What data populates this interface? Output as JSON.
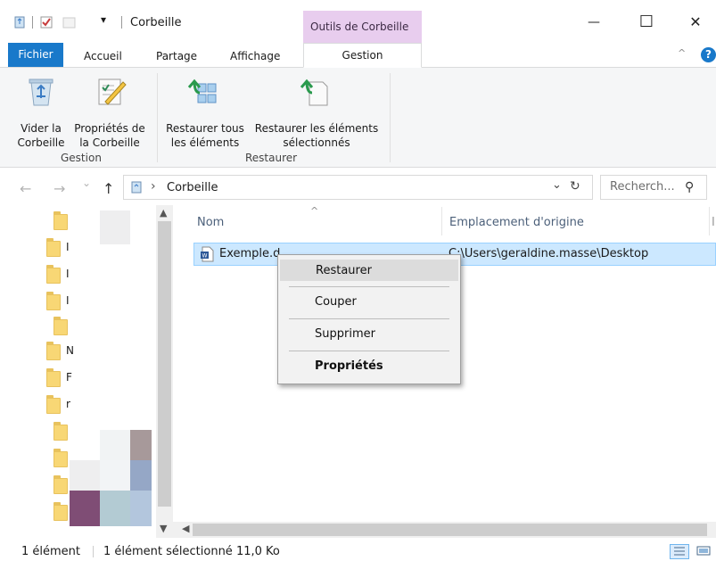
{
  "window": {
    "title": "Corbeille",
    "context_tab_header": "Outils de Corbeille",
    "minimize_glyph": "—",
    "maximize_glyph": "☐",
    "close_glyph": "✕"
  },
  "ribbon_tabs": {
    "file": "Fichier",
    "home": "Accueil",
    "share": "Partage",
    "view": "Affichage",
    "manage": "Gestion",
    "help_glyph": "?",
    "collapse_glyph": "^"
  },
  "ribbon": {
    "empty_bin_line1": "Vider la",
    "empty_bin_line2": "Corbeille",
    "bin_props_line1": "Propriétés de",
    "bin_props_line2": "la Corbeille",
    "group_manage": "Gestion",
    "restore_all_line1": "Restaurer tous",
    "restore_all_line2": "les éléments",
    "restore_sel_line1": "Restaurer les éléments",
    "restore_sel_line2": "sélectionnés",
    "group_restore": "Restaurer"
  },
  "address": {
    "back_glyph": "←",
    "forward_glyph": "→",
    "recent_glyph": "⌄",
    "up_glyph": "↑",
    "separator_glyph": "›",
    "location": "Corbeille",
    "dropdown_glyph": "⌄",
    "refresh_glyph": "↻",
    "search_placeholder": "Recherch...",
    "search_glyph": "⚲"
  },
  "navpane": {
    "labels": [
      "I",
      "I",
      "I",
      "N",
      "F",
      "r"
    ]
  },
  "filelist": {
    "columns": {
      "name": "Nom",
      "location": "Emplacement d'origine",
      "more": "I"
    },
    "sort_glyph": "^",
    "rows": [
      {
        "name": "Exemple.d",
        "location": "C:\\Users\\geraldine.masse\\Desktop"
      }
    ]
  },
  "context_menu": {
    "items": [
      "Restaurer",
      "Couper",
      "Supprimer",
      "Propriétés"
    ]
  },
  "statusbar": {
    "count": "1 élément",
    "selection": "1 élément sélectionné 11,0 Ko"
  },
  "colors": {
    "accent": "#1979ca",
    "context_tab": "#e8cdee",
    "selection_fill": "#cce8ff",
    "selection_border": "#99d1ff",
    "folder": "#f8d775"
  }
}
